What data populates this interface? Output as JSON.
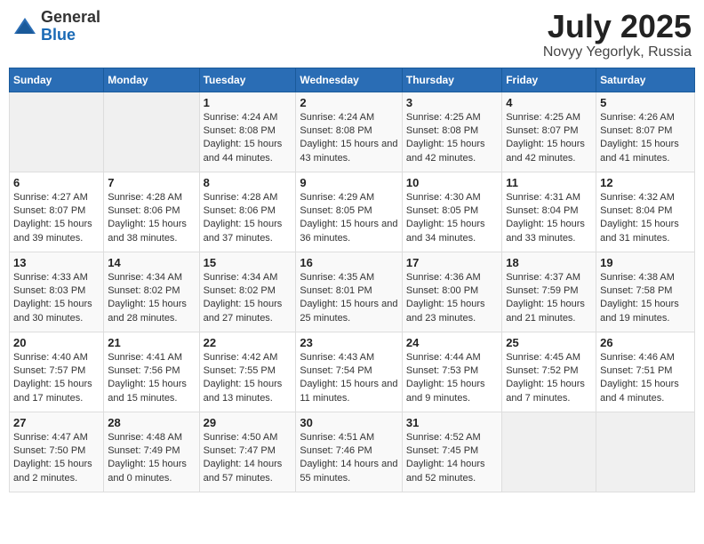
{
  "header": {
    "logo_general": "General",
    "logo_blue": "Blue",
    "month_year": "July 2025",
    "location": "Novyy Yegorlyk, Russia"
  },
  "columns": [
    "Sunday",
    "Monday",
    "Tuesday",
    "Wednesday",
    "Thursday",
    "Friday",
    "Saturday"
  ],
  "weeks": [
    {
      "cells": [
        {
          "day": "",
          "empty": true
        },
        {
          "day": "",
          "empty": true
        },
        {
          "day": "1",
          "sunrise": "Sunrise: 4:24 AM",
          "sunset": "Sunset: 8:08 PM",
          "daylight": "Daylight: 15 hours and 44 minutes."
        },
        {
          "day": "2",
          "sunrise": "Sunrise: 4:24 AM",
          "sunset": "Sunset: 8:08 PM",
          "daylight": "Daylight: 15 hours and 43 minutes."
        },
        {
          "day": "3",
          "sunrise": "Sunrise: 4:25 AM",
          "sunset": "Sunset: 8:08 PM",
          "daylight": "Daylight: 15 hours and 42 minutes."
        },
        {
          "day": "4",
          "sunrise": "Sunrise: 4:25 AM",
          "sunset": "Sunset: 8:07 PM",
          "daylight": "Daylight: 15 hours and 42 minutes."
        },
        {
          "day": "5",
          "sunrise": "Sunrise: 4:26 AM",
          "sunset": "Sunset: 8:07 PM",
          "daylight": "Daylight: 15 hours and 41 minutes."
        }
      ]
    },
    {
      "cells": [
        {
          "day": "6",
          "sunrise": "Sunrise: 4:27 AM",
          "sunset": "Sunset: 8:07 PM",
          "daylight": "Daylight: 15 hours and 39 minutes."
        },
        {
          "day": "7",
          "sunrise": "Sunrise: 4:28 AM",
          "sunset": "Sunset: 8:06 PM",
          "daylight": "Daylight: 15 hours and 38 minutes."
        },
        {
          "day": "8",
          "sunrise": "Sunrise: 4:28 AM",
          "sunset": "Sunset: 8:06 PM",
          "daylight": "Daylight: 15 hours and 37 minutes."
        },
        {
          "day": "9",
          "sunrise": "Sunrise: 4:29 AM",
          "sunset": "Sunset: 8:05 PM",
          "daylight": "Daylight: 15 hours and 36 minutes."
        },
        {
          "day": "10",
          "sunrise": "Sunrise: 4:30 AM",
          "sunset": "Sunset: 8:05 PM",
          "daylight": "Daylight: 15 hours and 34 minutes."
        },
        {
          "day": "11",
          "sunrise": "Sunrise: 4:31 AM",
          "sunset": "Sunset: 8:04 PM",
          "daylight": "Daylight: 15 hours and 33 minutes."
        },
        {
          "day": "12",
          "sunrise": "Sunrise: 4:32 AM",
          "sunset": "Sunset: 8:04 PM",
          "daylight": "Daylight: 15 hours and 31 minutes."
        }
      ]
    },
    {
      "cells": [
        {
          "day": "13",
          "sunrise": "Sunrise: 4:33 AM",
          "sunset": "Sunset: 8:03 PM",
          "daylight": "Daylight: 15 hours and 30 minutes."
        },
        {
          "day": "14",
          "sunrise": "Sunrise: 4:34 AM",
          "sunset": "Sunset: 8:02 PM",
          "daylight": "Daylight: 15 hours and 28 minutes."
        },
        {
          "day": "15",
          "sunrise": "Sunrise: 4:34 AM",
          "sunset": "Sunset: 8:02 PM",
          "daylight": "Daylight: 15 hours and 27 minutes."
        },
        {
          "day": "16",
          "sunrise": "Sunrise: 4:35 AM",
          "sunset": "Sunset: 8:01 PM",
          "daylight": "Daylight: 15 hours and 25 minutes."
        },
        {
          "day": "17",
          "sunrise": "Sunrise: 4:36 AM",
          "sunset": "Sunset: 8:00 PM",
          "daylight": "Daylight: 15 hours and 23 minutes."
        },
        {
          "day": "18",
          "sunrise": "Sunrise: 4:37 AM",
          "sunset": "Sunset: 7:59 PM",
          "daylight": "Daylight: 15 hours and 21 minutes."
        },
        {
          "day": "19",
          "sunrise": "Sunrise: 4:38 AM",
          "sunset": "Sunset: 7:58 PM",
          "daylight": "Daylight: 15 hours and 19 minutes."
        }
      ]
    },
    {
      "cells": [
        {
          "day": "20",
          "sunrise": "Sunrise: 4:40 AM",
          "sunset": "Sunset: 7:57 PM",
          "daylight": "Daylight: 15 hours and 17 minutes."
        },
        {
          "day": "21",
          "sunrise": "Sunrise: 4:41 AM",
          "sunset": "Sunset: 7:56 PM",
          "daylight": "Daylight: 15 hours and 15 minutes."
        },
        {
          "day": "22",
          "sunrise": "Sunrise: 4:42 AM",
          "sunset": "Sunset: 7:55 PM",
          "daylight": "Daylight: 15 hours and 13 minutes."
        },
        {
          "day": "23",
          "sunrise": "Sunrise: 4:43 AM",
          "sunset": "Sunset: 7:54 PM",
          "daylight": "Daylight: 15 hours and 11 minutes."
        },
        {
          "day": "24",
          "sunrise": "Sunrise: 4:44 AM",
          "sunset": "Sunset: 7:53 PM",
          "daylight": "Daylight: 15 hours and 9 minutes."
        },
        {
          "day": "25",
          "sunrise": "Sunrise: 4:45 AM",
          "sunset": "Sunset: 7:52 PM",
          "daylight": "Daylight: 15 hours and 7 minutes."
        },
        {
          "day": "26",
          "sunrise": "Sunrise: 4:46 AM",
          "sunset": "Sunset: 7:51 PM",
          "daylight": "Daylight: 15 hours and 4 minutes."
        }
      ]
    },
    {
      "cells": [
        {
          "day": "27",
          "sunrise": "Sunrise: 4:47 AM",
          "sunset": "Sunset: 7:50 PM",
          "daylight": "Daylight: 15 hours and 2 minutes."
        },
        {
          "day": "28",
          "sunrise": "Sunrise: 4:48 AM",
          "sunset": "Sunset: 7:49 PM",
          "daylight": "Daylight: 15 hours and 0 minutes."
        },
        {
          "day": "29",
          "sunrise": "Sunrise: 4:50 AM",
          "sunset": "Sunset: 7:47 PM",
          "daylight": "Daylight: 14 hours and 57 minutes."
        },
        {
          "day": "30",
          "sunrise": "Sunrise: 4:51 AM",
          "sunset": "Sunset: 7:46 PM",
          "daylight": "Daylight: 14 hours and 55 minutes."
        },
        {
          "day": "31",
          "sunrise": "Sunrise: 4:52 AM",
          "sunset": "Sunset: 7:45 PM",
          "daylight": "Daylight: 14 hours and 52 minutes."
        },
        {
          "day": "",
          "empty": true
        },
        {
          "day": "",
          "empty": true
        }
      ]
    }
  ]
}
